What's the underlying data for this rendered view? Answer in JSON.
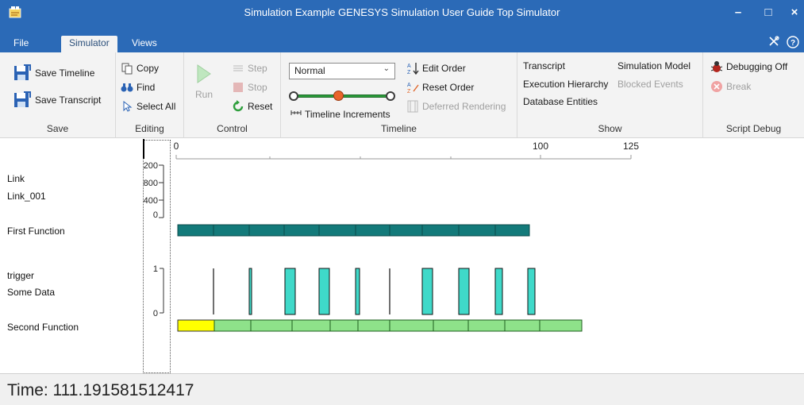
{
  "window": {
    "title": "Simulation Example GENESYS Simulation User Guide Top Simulator",
    "minimize": "–",
    "maximize": "□",
    "close": "×"
  },
  "tabs": [
    {
      "label": "File"
    },
    {
      "label": "Simulator"
    },
    {
      "label": "Views"
    }
  ],
  "ribbon": {
    "save": {
      "group_label": "Save",
      "save_timeline": "Save Timeline",
      "save_transcript": "Save Transcript"
    },
    "editing": {
      "group_label": "Editing",
      "copy": "Copy",
      "find": "Find",
      "select_all": "Select All"
    },
    "control": {
      "group_label": "Control",
      "run": "Run",
      "step": "Step",
      "stop": "Stop",
      "reset": "Reset"
    },
    "timeline": {
      "group_label": "Timeline",
      "speed_value": "Normal",
      "edit_order": "Edit Order",
      "reset_order": "Reset Order",
      "timeline_increments": "Timeline Increments",
      "deferred_rendering": "Deferred Rendering",
      "zoom_level": 0.45
    },
    "show": {
      "group_label": "Show",
      "transcript": "Transcript",
      "simulation_model": "Simulation Model",
      "execution_hierarchy": "Execution Hierarchy",
      "blocked_events": "Blocked Events",
      "database_entities": "Database Entities"
    },
    "script_debug": {
      "group_label": "Script Debug",
      "debugging_off": "Debugging Off",
      "break": "Break"
    }
  },
  "timeline": {
    "axis_labels": [
      "0",
      "100",
      "125"
    ],
    "rows": [
      "Link",
      "Link_001",
      "First Function",
      "trigger",
      "Some Data",
      "Second Function"
    ],
    "resource_ticks": [
      "200",
      "800",
      "400",
      "0"
    ],
    "trigger_ticks": [
      "1",
      "0"
    ]
  },
  "colors": {
    "accent": "#2b6ab7",
    "first_function": "#137a7a",
    "trigger_pulse": "#3fd9c9",
    "second_function": "#8ee28a",
    "second_function_active": "#ffff00"
  },
  "status": {
    "time_label": "Time: 111.191581512417"
  }
}
